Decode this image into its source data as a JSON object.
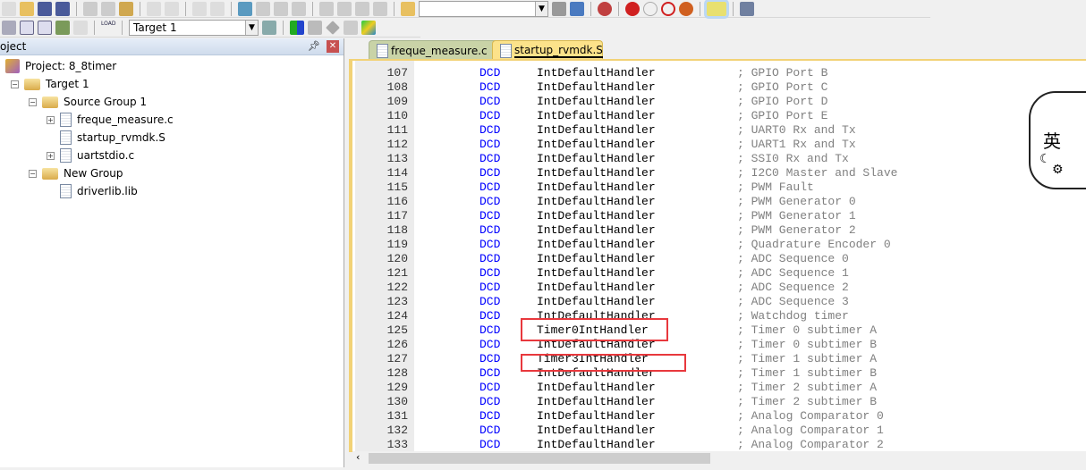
{
  "toolbar": {
    "target_select": "Target 1",
    "load_label": "LOAD"
  },
  "project_panel": {
    "title": "oject",
    "tree": [
      {
        "label": "Project: 8_8timer",
        "level": 0,
        "type": "project"
      },
      {
        "label": "Target 1",
        "level": 1,
        "type": "target",
        "expander": "−"
      },
      {
        "label": "Source Group 1",
        "level": 2,
        "type": "folder",
        "expander": "−"
      },
      {
        "label": "freque_measure.c",
        "level": 3,
        "type": "file",
        "expander": "+"
      },
      {
        "label": "startup_rvmdk.S",
        "level": 3,
        "type": "file",
        "expander": ""
      },
      {
        "label": "uartstdio.c",
        "level": 3,
        "type": "file",
        "expander": "+"
      },
      {
        "label": "New Group",
        "level": 2,
        "type": "folder",
        "expander": "−"
      },
      {
        "label": "driverlib.lib",
        "level": 3,
        "type": "file",
        "expander": ""
      }
    ]
  },
  "tabs": [
    {
      "label": "freque_measure.c",
      "active": false
    },
    {
      "label": "startup_rvmdk.S",
      "active": true
    }
  ],
  "code": [
    [
      "107",
      "DCD",
      "IntDefaultHandler",
      "; GPIO Port B"
    ],
    [
      "108",
      "DCD",
      "IntDefaultHandler",
      "; GPIO Port C"
    ],
    [
      "109",
      "DCD",
      "IntDefaultHandler",
      "; GPIO Port D"
    ],
    [
      "110",
      "DCD",
      "IntDefaultHandler",
      "; GPIO Port E"
    ],
    [
      "111",
      "DCD",
      "IntDefaultHandler",
      "; UART0 Rx and Tx"
    ],
    [
      "112",
      "DCD",
      "IntDefaultHandler",
      "; UART1 Rx and Tx"
    ],
    [
      "113",
      "DCD",
      "IntDefaultHandler",
      "; SSI0 Rx and Tx"
    ],
    [
      "114",
      "DCD",
      "IntDefaultHandler",
      "; I2C0 Master and Slave"
    ],
    [
      "115",
      "DCD",
      "IntDefaultHandler",
      "; PWM Fault"
    ],
    [
      "116",
      "DCD",
      "IntDefaultHandler",
      "; PWM Generator 0"
    ],
    [
      "117",
      "DCD",
      "IntDefaultHandler",
      "; PWM Generator 1"
    ],
    [
      "118",
      "DCD",
      "IntDefaultHandler",
      "; PWM Generator 2"
    ],
    [
      "119",
      "DCD",
      "IntDefaultHandler",
      "; Quadrature Encoder 0"
    ],
    [
      "120",
      "DCD",
      "IntDefaultHandler",
      "; ADC Sequence 0"
    ],
    [
      "121",
      "DCD",
      "IntDefaultHandler",
      "; ADC Sequence 1"
    ],
    [
      "122",
      "DCD",
      "IntDefaultHandler",
      "; ADC Sequence 2"
    ],
    [
      "123",
      "DCD",
      "IntDefaultHandler",
      "; ADC Sequence 3"
    ],
    [
      "124",
      "DCD",
      "IntDefaultHandler",
      "; Watchdog timer"
    ],
    [
      "125",
      "DCD",
      "Timer0IntHandler",
      "; Timer 0 subtimer A"
    ],
    [
      "126",
      "DCD",
      "IntDefaultHandler",
      "; Timer 0 subtimer B"
    ],
    [
      "127",
      "DCD",
      "Timer3IntHandler",
      "; Timer 1 subtimer A"
    ],
    [
      "128",
      "DCD",
      "IntDefaultHandler",
      "; Timer 1 subtimer B"
    ],
    [
      "129",
      "DCD",
      "IntDefaultHandler",
      "; Timer 2 subtimer A"
    ],
    [
      "130",
      "DCD",
      "IntDefaultHandler",
      "; Timer 2 subtimer B"
    ],
    [
      "131",
      "DCD",
      "IntDefaultHandler",
      "; Analog Comparator 0"
    ],
    [
      "132",
      "DCD",
      "IntDefaultHandler",
      "; Analog Comparator 1"
    ],
    [
      "133",
      "DCD",
      "IntDefaultHandler",
      "; Analog Comparator 2"
    ]
  ],
  "ime": {
    "label": "英"
  },
  "colors": {
    "keyword": "#0000ff",
    "comment": "#808080",
    "highlight_box": "#e8383d",
    "active_tab": "#fce28a",
    "inactive_tab": "#c9d3a7"
  }
}
